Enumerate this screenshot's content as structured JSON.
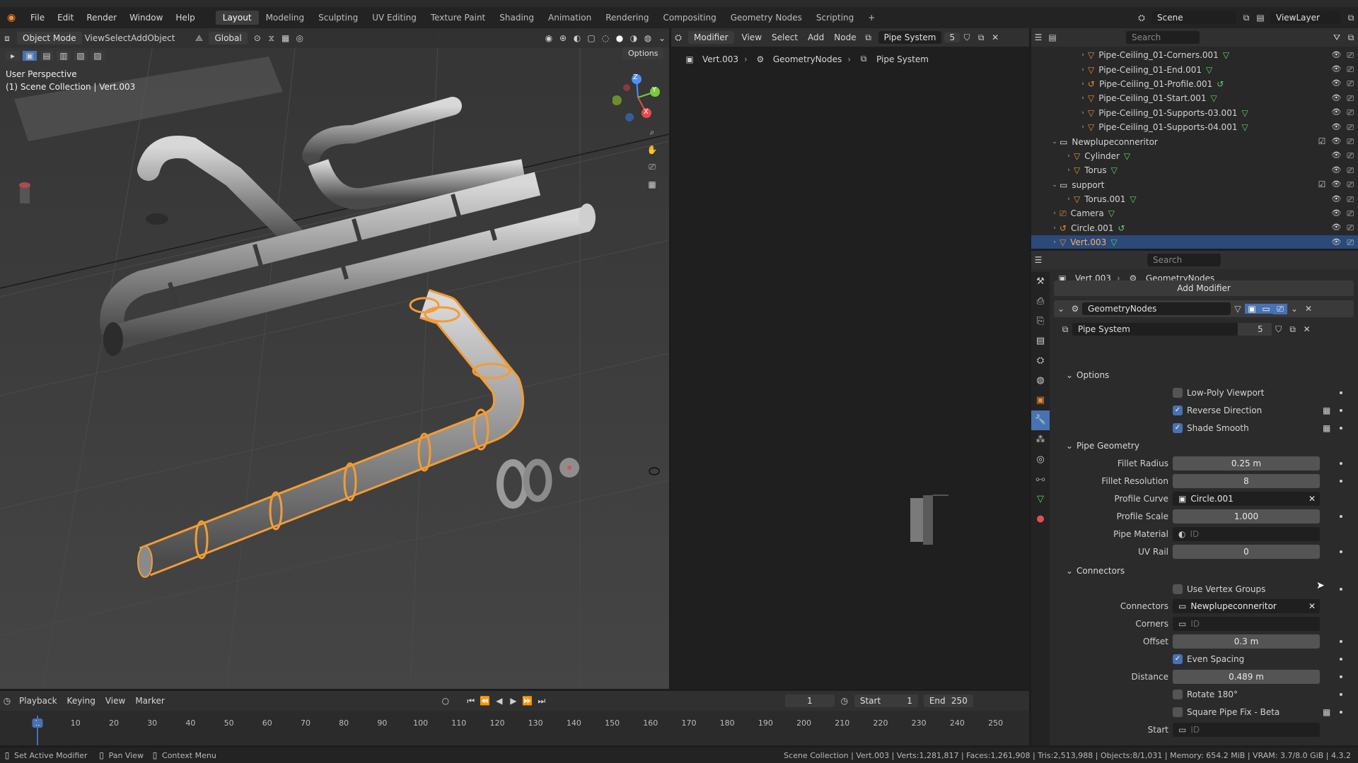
{
  "menubar": {
    "items": [
      "File",
      "Edit",
      "Render",
      "Window",
      "Help"
    ],
    "workspaces": [
      "Layout",
      "Modeling",
      "Sculpting",
      "UV Editing",
      "Texture Paint",
      "Shading",
      "Animation",
      "Rendering",
      "Compositing",
      "Geometry Nodes",
      "Scripting"
    ],
    "active_workspace": "Layout",
    "scene": "Scene",
    "view_layer": "ViewLayer"
  },
  "viewport": {
    "mode": "Object Mode",
    "menu": [
      "View",
      "Select",
      "Add",
      "Object"
    ],
    "transform": "Global",
    "options": "Options",
    "info_line1": "User Perspective",
    "info_line2": "(1) Scene Collection | Vert.003",
    "gizmo_axes": [
      "Z",
      "Y",
      "X"
    ]
  },
  "node_editor": {
    "type": "Modifier",
    "menu": [
      "View",
      "Select",
      "Add",
      "Node"
    ],
    "node_group": "Pipe System",
    "users": "5",
    "breadcrumb": [
      "Vert.003",
      "GeometryNodes",
      "Pipe System"
    ]
  },
  "outliner": {
    "search_placeholder": "Search",
    "rows": [
      {
        "name": "Pipe-Ceiling_01-Corners.001",
        "indent": 3,
        "kind": "mesh"
      },
      {
        "name": "Pipe-Ceiling_01-End.001",
        "indent": 3,
        "kind": "mesh"
      },
      {
        "name": "Pipe-Ceiling_01-Profile.001",
        "indent": 3,
        "kind": "curve"
      },
      {
        "name": "Pipe-Ceiling_01-Start.001",
        "indent": 3,
        "kind": "mesh"
      },
      {
        "name": "Pipe-Ceiling_01-Supports-03.001",
        "indent": 3,
        "kind": "mesh"
      },
      {
        "name": "Pipe-Ceiling_01-Supports-04.001",
        "indent": 3,
        "kind": "mesh"
      },
      {
        "name": "Newplupeconneritor",
        "indent": 1,
        "kind": "collection"
      },
      {
        "name": "Cylinder",
        "indent": 2,
        "kind": "mesh"
      },
      {
        "name": "Torus",
        "indent": 2,
        "kind": "mesh"
      },
      {
        "name": "support",
        "indent": 1,
        "kind": "collection"
      },
      {
        "name": "Torus.001",
        "indent": 2,
        "kind": "mesh"
      },
      {
        "name": "Camera",
        "indent": 1,
        "kind": "camera"
      },
      {
        "name": "Circle.001",
        "indent": 1,
        "kind": "curve"
      },
      {
        "name": "Vert.003",
        "indent": 1,
        "kind": "mesh",
        "selected": true
      }
    ]
  },
  "properties": {
    "search_placeholder": "Search",
    "breadcrumb": [
      "Vert.003",
      "GeometryNodes"
    ],
    "add_modifier": "Add Modifier",
    "modifier_name": "GeometryNodes",
    "node_group": "Pipe System",
    "node_group_users": "5",
    "options_header": "Options",
    "low_poly": "Low-Poly Viewport",
    "reverse_direction": "Reverse Direction",
    "shade_smooth": "Shade Smooth",
    "pipe_geometry_header": "Pipe Geometry",
    "fillet_radius_label": "Fillet Radius",
    "fillet_radius": "0.25 m",
    "fillet_resolution_label": "Fillet Resolution",
    "fillet_resolution": "8",
    "profile_curve_label": "Profile Curve",
    "profile_curve": "Circle.001",
    "profile_scale_label": "Profile Scale",
    "profile_scale": "1.000",
    "pipe_material_label": "Pipe Material",
    "pipe_material": "ID",
    "uv_rail_label": "UV Rail",
    "uv_rail": "0",
    "connectors_header": "Connectors",
    "use_vertex_groups": "Use Vertex Groups",
    "connectors_label": "Connectors",
    "connectors": "Newplupeconneritor",
    "corners_label": "Corners",
    "corners": "ID",
    "offset_label": "Offset",
    "offset": "0.3 m",
    "even_spacing": "Even Spacing",
    "distance_label": "Distance",
    "distance": "0.489 m",
    "rotate_180": "Rotate 180°",
    "square_pipe_fix": "Square Pipe Fix - Beta",
    "start_label": "Start",
    "start": "ID"
  },
  "timeline": {
    "menu": [
      "Playback",
      "Keying",
      "View",
      "Marker"
    ],
    "current_frame": "1",
    "start_label": "Start",
    "start": "1",
    "end_label": "End",
    "end": "250",
    "ticks": [
      "1",
      "10",
      "20",
      "30",
      "40",
      "50",
      "60",
      "70",
      "80",
      "90",
      "100",
      "110",
      "120",
      "130",
      "140",
      "150",
      "160",
      "170",
      "180",
      "190",
      "200",
      "210",
      "220",
      "230",
      "240",
      "250"
    ]
  },
  "statusbar": {
    "left": [
      "Set Active Modifier",
      "Pan View",
      "Context Menu"
    ],
    "stats": "Scene Collection | Vert.003 | Verts:1,281,817 | Faces:1,261,908 | Tris:2,513,988 | Objects:8/1,031 | Memory: 654.2 MiB | VRAM: 3.7/8.0 GiB | 4.3.2"
  },
  "colors": {
    "accent_blue": "#4772b3",
    "selection_orange": "#f39c34",
    "outliner_selected": "#2b4a7a",
    "mesh_icon": "#e88b3a"
  }
}
